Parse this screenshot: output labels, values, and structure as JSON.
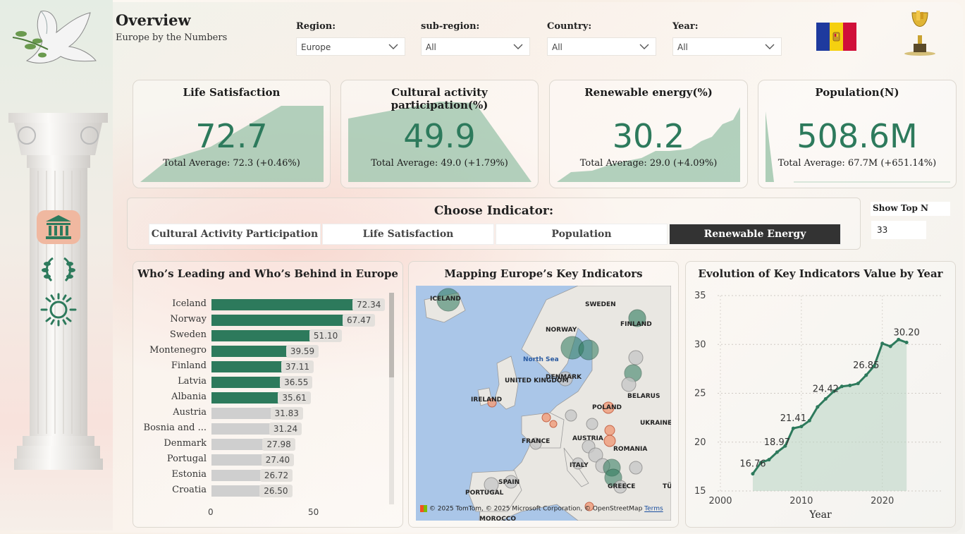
{
  "header": {
    "title": "Overview",
    "subtitle": "Europe by the Numbers"
  },
  "filters": [
    {
      "label": "Region:",
      "value": "Europe"
    },
    {
      "label": "sub-region:",
      "value": "All"
    },
    {
      "label": "Country:",
      "value": "All"
    },
    {
      "label": "Year:",
      "value": "All"
    }
  ],
  "colors": {
    "accent": "#2d7a5c",
    "area": "#9ac3a9",
    "selected": "#333333",
    "flag_blue": "#1e3a9e",
    "flag_yellow": "#f5d010",
    "flag_red": "#d0103a"
  },
  "kpis": [
    {
      "title": "Life Satisfaction",
      "value": "72.7",
      "avg": "Total Average: 72.3 (+0.46%)"
    },
    {
      "title": "Cultural activity participation(%)",
      "value": "49.9",
      "avg": "Total Average: 49.0 (+1.79%)"
    },
    {
      "title": "Renewable energy(%)",
      "value": "30.2",
      "avg": "Total Average: 29.0 (+4.09%)"
    },
    {
      "title": "Population(N)",
      "value": "508.6M",
      "avg": "Total Average: 67.7M (+651.14%)"
    }
  ],
  "indicator": {
    "title": "Choose Indicator:",
    "options": [
      "Cultural Activity Participation",
      "Life Satisfaction",
      "Population",
      "Renewable Energy"
    ],
    "selected": "Renewable Energy"
  },
  "topn": {
    "label": "Show Top N",
    "value": "33"
  },
  "leaders": {
    "title": "Who’s Leading and Who’s Behind in Europe",
    "axis_ticks": [
      "0",
      "50"
    ],
    "rows": [
      {
        "country": "Iceland",
        "value": "72.34",
        "v": 72.34,
        "top": true
      },
      {
        "country": "Norway",
        "value": "67.47",
        "v": 67.47,
        "top": true
      },
      {
        "country": "Sweden",
        "value": "51.10",
        "v": 51.1,
        "top": true
      },
      {
        "country": "Montenegro",
        "value": "39.59",
        "v": 39.59,
        "top": true
      },
      {
        "country": "Finland",
        "value": "37.11",
        "v": 37.11,
        "top": true
      },
      {
        "country": "Latvia",
        "value": "36.55",
        "v": 36.55,
        "top": true
      },
      {
        "country": "Albania",
        "value": "35.61",
        "v": 35.61,
        "top": true
      },
      {
        "country": "Austria",
        "value": "31.83",
        "v": 31.83,
        "top": false
      },
      {
        "country": "Bosnia and ...",
        "value": "31.24",
        "v": 31.24,
        "top": false
      },
      {
        "country": "Denmark",
        "value": "27.98",
        "v": 27.98,
        "top": false
      },
      {
        "country": "Portugal",
        "value": "27.40",
        "v": 27.4,
        "top": false
      },
      {
        "country": "Estonia",
        "value": "26.72",
        "v": 26.72,
        "top": false
      },
      {
        "country": "Croatia",
        "value": "26.50",
        "v": 26.5,
        "top": false
      }
    ]
  },
  "map": {
    "title": "Mapping Europe’s Key Indicators",
    "labels": [
      "ICELAND",
      "SWEDEN",
      "NORWAY",
      "FINLAND",
      "North Sea",
      "UNITED KINGDOM",
      "DENMARK",
      "IRELAND",
      "BELARUS",
      "POLAND",
      "UKRAINE",
      "FRANCE",
      "AUSTRIA",
      "ROMANIA",
      "ITALY",
      "SPAIN",
      "PORTUGAL",
      "GREECE",
      "TÜ",
      "MOROCCO"
    ],
    "credit": "© 2025 TomTom, © 2025 Microsoft Corporation, © OpenStreetMap",
    "terms": "Terms"
  },
  "evolution": {
    "title": "Evolution of Key Indicators Value by Year",
    "xlabel": "Year"
  },
  "chart_data": {
    "type": "area",
    "title": "Evolution of Key Indicators Value by Year",
    "xlabel": "Year",
    "ylabel": "",
    "xlim": [
      2000,
      2023
    ],
    "ylim": [
      15,
      35
    ],
    "x_ticks": [
      "2000",
      "2010",
      "2020"
    ],
    "y_ticks": [
      "15",
      "20",
      "25",
      "30",
      "35"
    ],
    "x": [
      2004,
      2005,
      2006,
      2007,
      2008,
      2009,
      2010,
      2011,
      2012,
      2013,
      2014,
      2015,
      2016,
      2017,
      2018,
      2019,
      2020,
      2021,
      2022,
      2023
    ],
    "values": [
      16.76,
      17.9,
      18.2,
      18.97,
      19.6,
      21.41,
      21.6,
      22.2,
      23.6,
      24.42,
      25.2,
      25.7,
      25.8,
      26.0,
      26.85,
      27.8,
      30.1,
      29.8,
      30.5,
      30.2
    ],
    "data_labels": [
      {
        "x": 2004,
        "text": "16.76"
      },
      {
        "x": 2007,
        "text": "18.97"
      },
      {
        "x": 2009,
        "text": "21.41"
      },
      {
        "x": 2013,
        "text": "24.42"
      },
      {
        "x": 2018,
        "text": "26.85"
      },
      {
        "x": 2023,
        "text": "30.20"
      }
    ]
  }
}
